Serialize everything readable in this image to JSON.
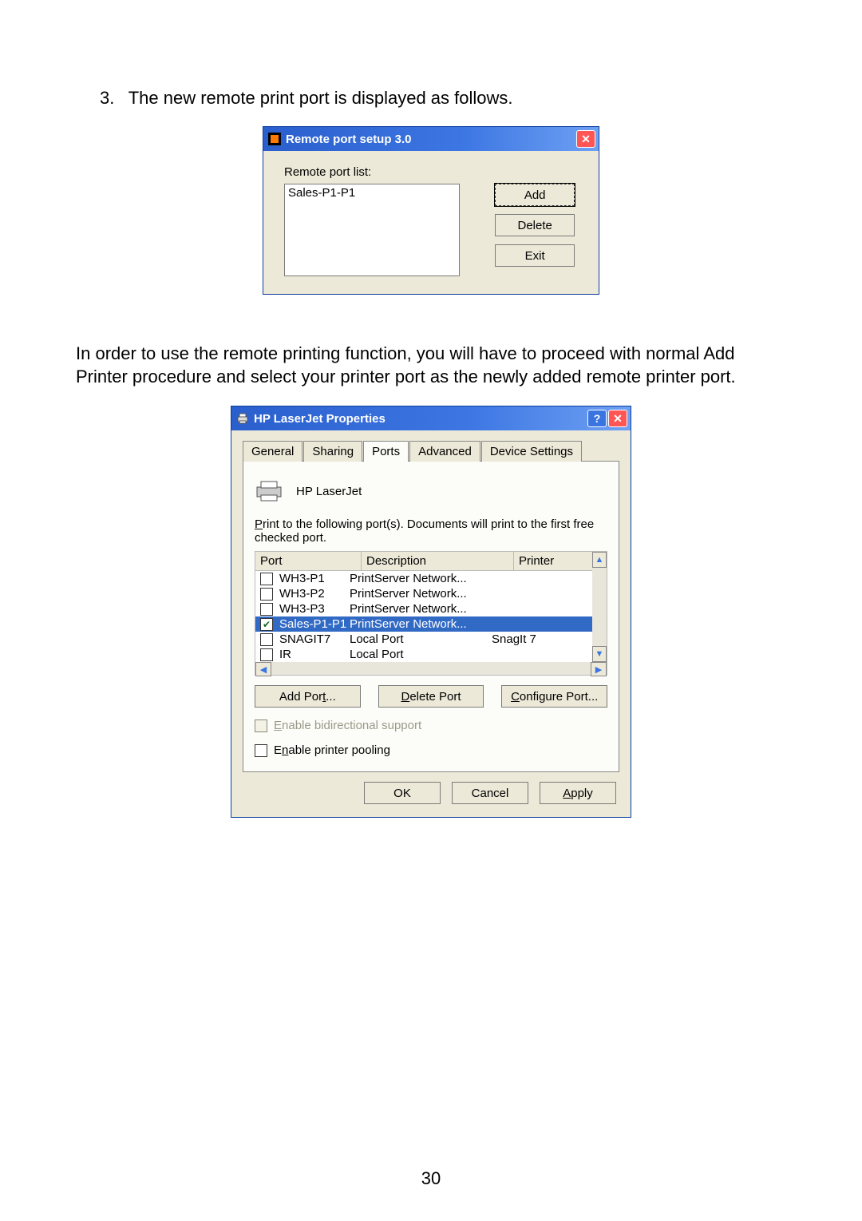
{
  "doc": {
    "step_number": "3.",
    "step_text": "The new remote print port is displayed as follows.",
    "para2": "In order to use the remote printing function, you will have to proceed with normal Add Printer procedure and select your printer port as the newly added remote printer port.",
    "page_number": "30"
  },
  "dialog1": {
    "title": "Remote port setup 3.0",
    "label": "Remote port list:",
    "list_item": "Sales-P1-P1",
    "buttons": {
      "add": "Add",
      "delete": "Delete",
      "exit": "Exit"
    }
  },
  "dialog2": {
    "title": "HP LaserJet Properties",
    "tabs": {
      "general": "General",
      "sharing": "Sharing",
      "ports": "Ports",
      "advanced": "Advanced",
      "device": "Device Settings"
    },
    "printer_name": "HP LaserJet",
    "help_prefix": "P",
    "help_text": "rint to the following port(s). Documents will print to the first free checked port.",
    "columns": {
      "port": "Port",
      "description": "Description",
      "printer": "Printer"
    },
    "rows": [
      {
        "checked": false,
        "port": "WH3-P1",
        "desc": "PrintServer Network...",
        "printer": "",
        "selected": false
      },
      {
        "checked": false,
        "port": "WH3-P2",
        "desc": "PrintServer Network...",
        "printer": "",
        "selected": false
      },
      {
        "checked": false,
        "port": "WH3-P3",
        "desc": "PrintServer Network...",
        "printer": "",
        "selected": false
      },
      {
        "checked": true,
        "port": "Sales-P1-P1",
        "desc": "PrintServer Network...",
        "printer": "",
        "selected": true
      },
      {
        "checked": false,
        "port": "SNAGIT7",
        "desc": "Local Port",
        "printer": "SnagIt 7",
        "selected": false
      },
      {
        "checked": false,
        "port": "IR",
        "desc": "Local Port",
        "printer": "",
        "selected": false
      }
    ],
    "port_buttons": {
      "add": {
        "u": "t",
        "pre": "Add Por",
        "post": "..."
      },
      "delete": {
        "u": "D",
        "post": "elete Port"
      },
      "configure": {
        "u": "C",
        "post": "onfigure Port..."
      }
    },
    "checkboxes": {
      "bidi": {
        "u": "E",
        "post": "nable bidirectional support",
        "enabled": false
      },
      "pool": {
        "u": "n",
        "pre": "E",
        "post": "able printer pooling",
        "enabled": true
      }
    },
    "bottom": {
      "ok": "OK",
      "cancel": "Cancel",
      "apply": {
        "u": "A",
        "post": "pply"
      }
    }
  }
}
